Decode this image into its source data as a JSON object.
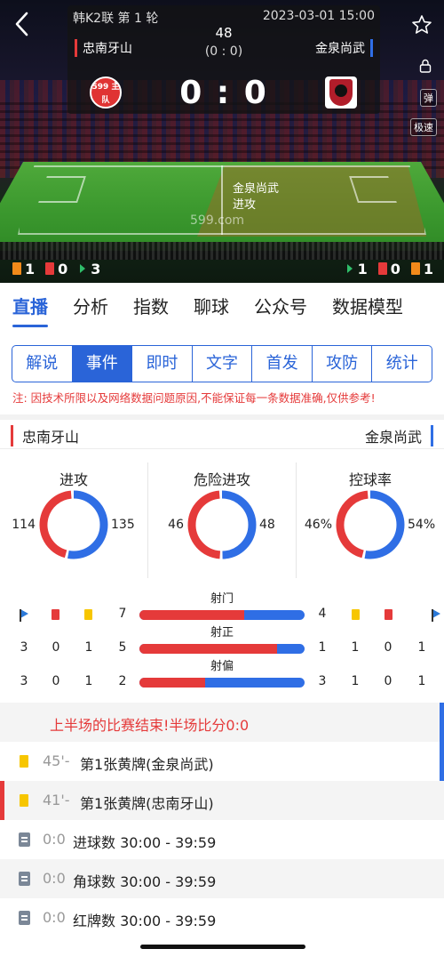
{
  "header": {
    "league": "韩K2联 第 1 轮",
    "datetime": "2023-03-01 15:00",
    "minute": "48",
    "halftime": "(0 : 0)",
    "home_team": "忠南牙山",
    "away_team": "金泉尚武",
    "score": "0 : 0",
    "home_logo_text": "599 主队",
    "side_buttons": [
      "弹",
      "极速"
    ]
  },
  "pitch": {
    "event_team": "金泉尚武",
    "event_action": "进攻",
    "watermark": "599.com"
  },
  "counts": {
    "home": {
      "yellow": "1",
      "red": "0",
      "corner": "3"
    },
    "away": {
      "corner": "1",
      "red": "0",
      "yellow": "1"
    }
  },
  "main_tabs": [
    "直播",
    "分析",
    "指数",
    "聊球",
    "公众号",
    "数据模型"
  ],
  "sub_tabs": [
    "解说",
    "事件",
    "即时",
    "文字",
    "首发",
    "攻防",
    "统计"
  ],
  "notice": "注: 因技术所限以及网络数据问题原因,不能保证每一条数据准确,仅供参考!",
  "teams": {
    "home": "忠南牙山",
    "away": "金泉尚武"
  },
  "donuts": [
    {
      "title": "进攻",
      "home": "114",
      "away": "135",
      "home_val": 114,
      "away_val": 135
    },
    {
      "title": "危险进攻",
      "home": "46",
      "away": "48",
      "home_val": 46,
      "away_val": 48
    },
    {
      "title": "控球率",
      "home": "46%",
      "away": "54%",
      "home_val": 46,
      "away_val": 54
    }
  ],
  "bar_stats": [
    {
      "label": "射门",
      "home": "7",
      "away": "4",
      "home_val": 7,
      "away_val": 4,
      "home_side": {
        "corner": "",
        "red": "",
        "yellow": ""
      },
      "away_side": {
        "yellow": "",
        "red": "",
        "corner": ""
      }
    },
    {
      "label": "射正",
      "home": "5",
      "away": "1",
      "home_val": 5,
      "away_val": 1,
      "home_side": {
        "corner": "3",
        "red": "0",
        "yellow": "1"
      },
      "away_side": {
        "yellow": "1",
        "red": "0",
        "corner": "1"
      }
    },
    {
      "label": "射偏",
      "home": "2",
      "away": "3",
      "home_val": 2,
      "away_val": 3,
      "home_side": {
        "corner": "3",
        "red": "0",
        "yellow": "1"
      },
      "away_side": {
        "yellow": "1",
        "red": "0",
        "corner": "1"
      }
    }
  ],
  "colors": {
    "home": "#e53a3a",
    "away": "#2f6ee5",
    "accent": "#2a64d8",
    "yellow": "#f7c600"
  },
  "events": [
    {
      "type": "headline",
      "text": "上半场的比赛结束!半场比分0:0",
      "side": "away"
    },
    {
      "type": "yellow-card",
      "time": "45'-",
      "text": "第1张黄牌(金泉尚武)",
      "side": "away"
    },
    {
      "type": "yellow-card",
      "time": "41'-",
      "text": "第1张黄牌(忠南牙山)",
      "side": "home"
    },
    {
      "type": "stat",
      "time": "0:0",
      "text": "进球数 30:00 - 39:59",
      "side": ""
    },
    {
      "type": "stat",
      "time": "0:0",
      "text": "角球数 30:00 - 39:59",
      "side": ""
    },
    {
      "type": "stat",
      "time": "0:0",
      "text": "红牌数 30:00 - 39:59",
      "side": ""
    }
  ]
}
